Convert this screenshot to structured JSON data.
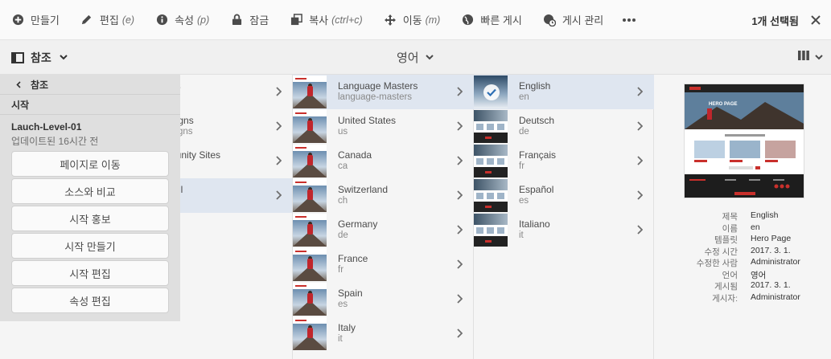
{
  "actionbar": {
    "items": [
      {
        "label": "만들기",
        "hint": "",
        "icon": "plus-circle-icon"
      },
      {
        "label": "편집",
        "hint": "(e)",
        "icon": "pencil-icon"
      },
      {
        "label": "속성",
        "hint": "(p)",
        "icon": "info-icon"
      },
      {
        "label": "잠금",
        "hint": "",
        "icon": "lock-icon"
      },
      {
        "label": "복사",
        "hint": "(ctrl+c)",
        "icon": "copy-icon"
      },
      {
        "label": "이동",
        "hint": "(m)",
        "icon": "move-icon"
      },
      {
        "label": "빠른 게시",
        "hint": "",
        "icon": "globe-icon"
      },
      {
        "label": "게시 관리",
        "hint": "",
        "icon": "globe-clock-icon"
      }
    ],
    "more_icon": "ellipsis-icon",
    "selection_count": "1개 선택됨",
    "close_icon": "close-icon"
  },
  "subbar": {
    "rail_label": "참조",
    "language": "영어",
    "view_icon": "column-view-icon"
  },
  "rail": {
    "back_label": "참조",
    "section": "시작",
    "launch_title": "Lauch-Level-01",
    "launch_sub": "업데이트된 16시간 전",
    "buttons": [
      "페이지로 이동",
      "소스와 비교",
      "시작 홍보",
      "시작 만들기",
      "시작 편집",
      "속성 편집"
    ]
  },
  "column1": [
    {
      "title": "ns",
      "sub": "s",
      "selected": false
    },
    {
      "title": "aigns",
      "sub": "aigns",
      "selected": false
    },
    {
      "title": "nunity Sites",
      "sub": "",
      "selected": false
    },
    {
      "title": "tail",
      "sub": "ail",
      "selected": true
    }
  ],
  "column2": [
    {
      "title": "Language Masters",
      "sub": "language-masters",
      "selected": true
    },
    {
      "title": "United States",
      "sub": "us",
      "selected": false
    },
    {
      "title": "Canada",
      "sub": "ca",
      "selected": false
    },
    {
      "title": "Switzerland",
      "sub": "ch",
      "selected": false
    },
    {
      "title": "Germany",
      "sub": "de",
      "selected": false
    },
    {
      "title": "France",
      "sub": "fr",
      "selected": false
    },
    {
      "title": "Spain",
      "sub": "es",
      "selected": false
    },
    {
      "title": "Italy",
      "sub": "it",
      "selected": false
    }
  ],
  "column3": [
    {
      "title": "English",
      "sub": "en",
      "selected": true
    },
    {
      "title": "Deutsch",
      "sub": "de",
      "selected": false
    },
    {
      "title": "Français",
      "sub": "fr",
      "selected": false
    },
    {
      "title": "Español",
      "sub": "es",
      "selected": false
    },
    {
      "title": "Italiano",
      "sub": "it",
      "selected": false
    }
  ],
  "meta": {
    "rows": [
      {
        "key": "제목",
        "value": "English"
      },
      {
        "key": "이름",
        "value": "en"
      },
      {
        "key": "템플릿",
        "value": "Hero Page"
      },
      {
        "key": "수정 시간",
        "value": "2017. 3. 1."
      },
      {
        "key": "수정한 사람",
        "value": "Administrator"
      },
      {
        "key": "언어",
        "value": "영어"
      },
      {
        "key": "게시됨",
        "value": "2017. 3. 1."
      },
      {
        "key": "게시자:",
        "value": "Administrator"
      }
    ]
  },
  "colors": {
    "selected_row": "#dfe6f0",
    "accent_red": "#c9302c"
  }
}
